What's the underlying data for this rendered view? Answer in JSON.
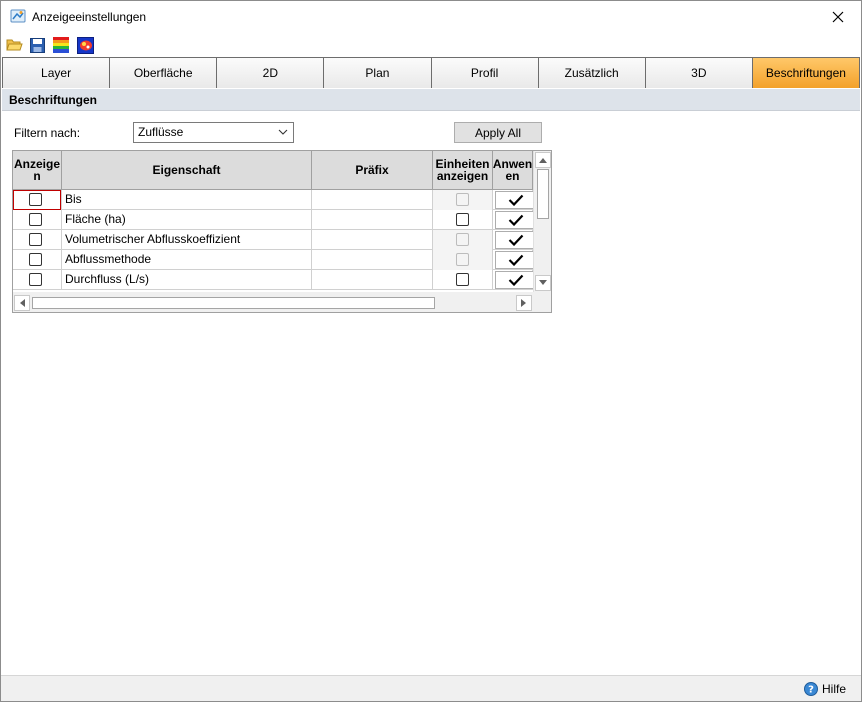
{
  "window": {
    "title": "Anzeigeeinstellungen"
  },
  "toolbar": {
    "buttons": [
      {
        "name": "open-folder-icon"
      },
      {
        "name": "save-icon"
      },
      {
        "name": "color-ramp-icon"
      },
      {
        "name": "palette-icon"
      }
    ]
  },
  "tabs": [
    {
      "label": "Layer",
      "active": false
    },
    {
      "label": "Oberfläche",
      "active": false
    },
    {
      "label": "2D",
      "active": false
    },
    {
      "label": "Plan",
      "active": false
    },
    {
      "label": "Profil",
      "active": false
    },
    {
      "label": "Zusätzlich",
      "active": false
    },
    {
      "label": "3D",
      "active": false
    },
    {
      "label": "Beschriftungen",
      "active": true
    }
  ],
  "section": {
    "title": "Beschriftungen"
  },
  "filter": {
    "label": "Filtern nach:",
    "value": "Zuflüsse",
    "apply_label": "Apply All"
  },
  "grid": {
    "headers": {
      "anzeigen": "Anzeige n",
      "eigenschaft": "Eigenschaft",
      "praefix": "Präfix",
      "einheiten": "Einheiten anzeigen",
      "anwenden": "Anwen en"
    },
    "rows": [
      {
        "eigenschaft": "Bis",
        "praefix": "",
        "anzeigen": false,
        "einheiten_enabled": false,
        "einheiten": false
      },
      {
        "eigenschaft": "Fläche (ha)",
        "praefix": "",
        "anzeigen": false,
        "einheiten_enabled": true,
        "einheiten": false
      },
      {
        "eigenschaft": "Volumetrischer Abflusskoeffizient",
        "praefix": "",
        "anzeigen": false,
        "einheiten_enabled": false,
        "einheiten": false
      },
      {
        "eigenschaft": "Abflussmethode",
        "praefix": "",
        "anzeigen": false,
        "einheiten_enabled": false,
        "einheiten": false
      },
      {
        "eigenschaft": "Durchfluss (L/s)",
        "praefix": "",
        "anzeigen": false,
        "einheiten_enabled": true,
        "einheiten": false
      }
    ]
  },
  "status": {
    "help_label": "Hilfe"
  },
  "colors": {
    "active_tab": "#f3a12a",
    "section_bg": "#dde3ea",
    "focus": "#c00000"
  }
}
